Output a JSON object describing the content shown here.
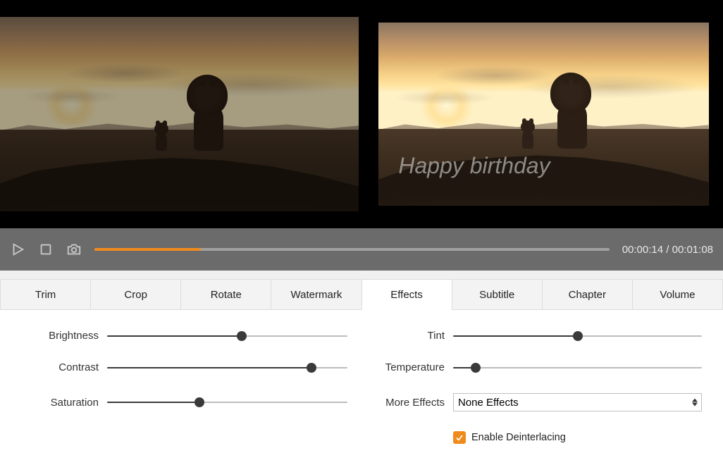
{
  "preview": {
    "watermark_text": "Happy birthday"
  },
  "playback": {
    "progress_percent": 20.6,
    "current_time": "00:00:14",
    "total_time": "00:01:08"
  },
  "tabs": [
    {
      "label": "Trim",
      "active": false
    },
    {
      "label": "Crop",
      "active": false
    },
    {
      "label": "Rotate",
      "active": false
    },
    {
      "label": "Watermark",
      "active": false
    },
    {
      "label": "Effects",
      "active": true
    },
    {
      "label": "Subtitle",
      "active": false
    },
    {
      "label": "Chapter",
      "active": false
    },
    {
      "label": "Volume",
      "active": false
    }
  ],
  "effects": {
    "brightness": {
      "label": "Brightness",
      "value": 56
    },
    "contrast": {
      "label": "Contrast",
      "value": 85
    },
    "saturation": {
      "label": "Saturation",
      "value": 38.5
    },
    "tint": {
      "label": "Tint",
      "value": 50
    },
    "temperature": {
      "label": "Temperature",
      "value": 9
    },
    "more_effects": {
      "label": "More Effects",
      "selected": "None Effects"
    },
    "deinterlace": {
      "label": "Enable Deinterlacing",
      "checked": true
    }
  },
  "icons": {
    "play": "play-icon",
    "stop": "stop-icon",
    "snapshot": "camera-icon",
    "select_arrows": "updown-icon",
    "check": "check-icon"
  },
  "colors": {
    "accent": "#f08a1d"
  }
}
